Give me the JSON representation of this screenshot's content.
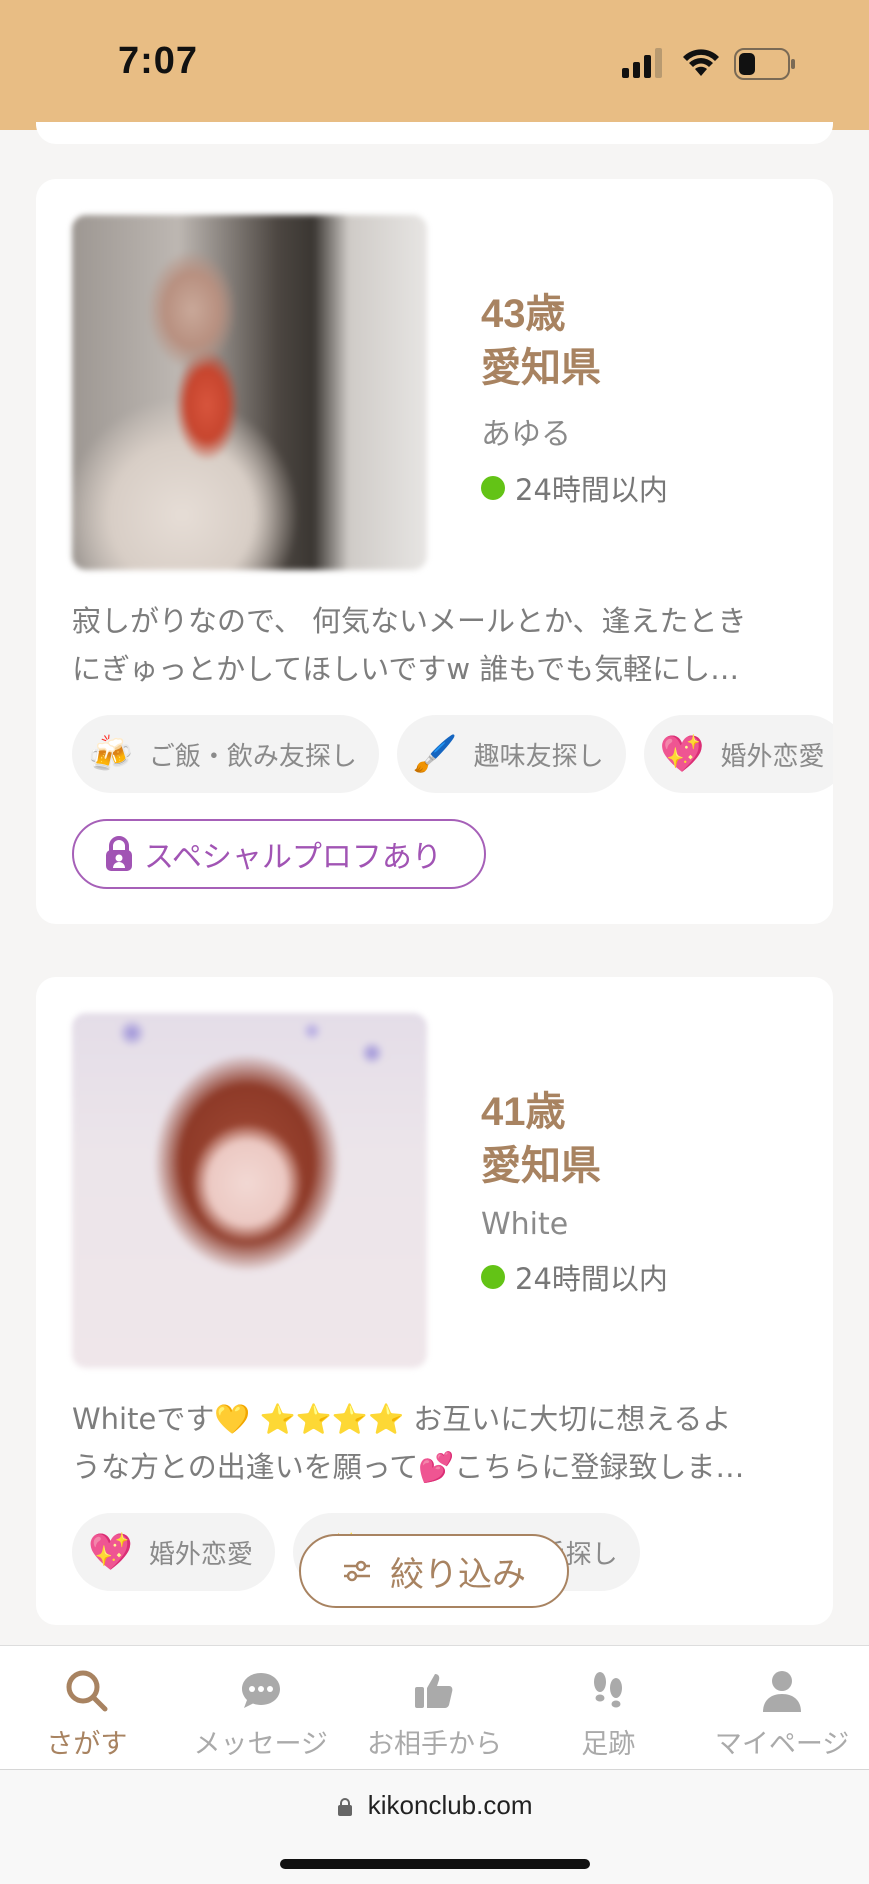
{
  "status_bar": {
    "time": "7:07"
  },
  "profiles": [
    {
      "age": "43歳",
      "prefecture": "愛知県",
      "nickname": "あゆる",
      "online": "24時間以内",
      "bio": "寂しがりなので、 何気ないメールとか、逢えたとき\nにぎゅっとかしてほしいですw 誰もでも気軽にし…",
      "tags": [
        {
          "icon": "beer-mugs-icon",
          "emoji": "🍻",
          "label": "ご飯・飲み友探し"
        },
        {
          "icon": "paintbrush-icon",
          "emoji": "🖌️",
          "label": "趣味友探し"
        },
        {
          "icon": "sparkling-heart-icon",
          "emoji": "💖",
          "label": "婚外恋愛"
        }
      ],
      "special_label": "スペシャルプロフあり"
    },
    {
      "age": "41歳",
      "prefecture": "愛知県",
      "nickname": "White",
      "online": "24時間以内",
      "bio": "Whiteです💛 ⭐⭐⭐⭐ お互いに大切に想えるよ\nうな方との出逢いを願って💕こちらに登録致しま…",
      "tags": [
        {
          "icon": "sparkling-heart-icon",
          "emoji": "💖",
          "label": "婚外恋愛"
        },
        {
          "icon": "sparkles-icon",
          "emoji": "✨",
          "label": "お相手探し"
        }
      ]
    }
  ],
  "filter_button": {
    "label": "絞り込み",
    "icon": "sliders-icon"
  },
  "bottom_nav": [
    {
      "label": "さがす",
      "icon": "search-icon",
      "active": true
    },
    {
      "label": "メッセージ",
      "icon": "chat-icon",
      "active": false
    },
    {
      "label": "お相手から",
      "icon": "thumbs-up-icon",
      "active": false
    },
    {
      "label": "足跡",
      "icon": "footprints-icon",
      "active": false
    },
    {
      "label": "マイページ",
      "icon": "person-icon",
      "active": false
    }
  ],
  "url_bar": {
    "url": "kikonclub.com"
  },
  "colors": {
    "header": "#e8bd84",
    "accent": "#a88361",
    "online": "#63c316",
    "special": "#a154b4"
  }
}
